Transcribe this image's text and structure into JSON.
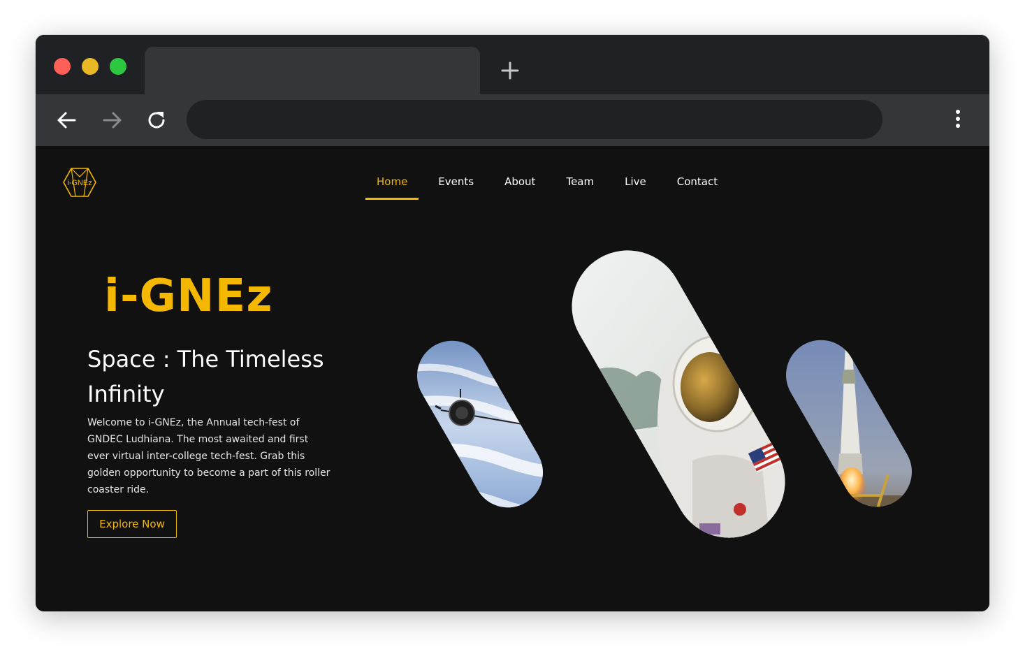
{
  "browser": {
    "new_tab_icon": "plus-icon",
    "back_icon": "arrow-left-icon",
    "forward_icon": "arrow-right-icon",
    "reload_icon": "reload-icon",
    "menu_icon": "more-vertical-icon",
    "traffic_lights": [
      "#fe5f57",
      "#e9b925",
      "#2bc840"
    ]
  },
  "site": {
    "logo_text": "i-GNEz",
    "nav": [
      {
        "label": "Home",
        "active": true
      },
      {
        "label": "Events",
        "active": false
      },
      {
        "label": "About",
        "active": false
      },
      {
        "label": "Team",
        "active": false
      },
      {
        "label": "Live",
        "active": false
      },
      {
        "label": "Contact",
        "active": false
      }
    ],
    "accent": "#f5b800",
    "background": "#111111"
  },
  "hero": {
    "title": "i-GNEz",
    "subtitle": "Space : The Timeless Infinity",
    "description": "Welcome to i-GNEz, the Annual tech-fest of GNDEC Ludhiana. The most awaited and first ever virtual inter-college tech-fest. Grab this golden opportunity to become a part of this roller coaster ride.",
    "cta_label": "Explore Now"
  },
  "images": [
    {
      "name": "satellite-image",
      "depicts": "satellite orbiting above clouds"
    },
    {
      "name": "astronaut-image",
      "depicts": "astronaut in spacesuit with US flag"
    },
    {
      "name": "rocket-image",
      "depicts": "rocket launching from pad"
    }
  ]
}
